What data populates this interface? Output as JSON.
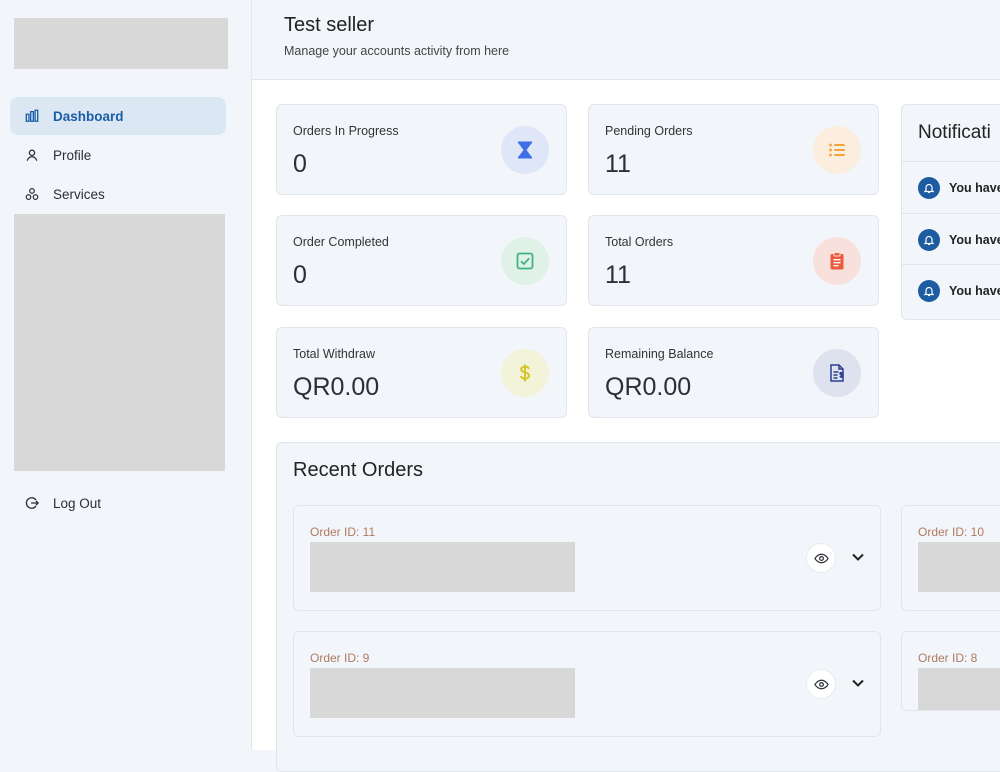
{
  "sidebar": {
    "items": [
      {
        "label": "Dashboard",
        "icon": "bar-chart-icon",
        "active": true
      },
      {
        "label": "Profile",
        "icon": "user-icon",
        "active": false
      },
      {
        "label": "Services",
        "icon": "services-icon",
        "active": false
      }
    ],
    "logout_label": "Log Out"
  },
  "header": {
    "title": "Test seller",
    "subtitle": "Manage your accounts activity from here"
  },
  "stats": [
    {
      "label": "Orders In Progress",
      "value": "0",
      "icon": "hourglass-icon",
      "color": "#3f6ee8"
    },
    {
      "label": "Pending Orders",
      "value": "11",
      "icon": "list-icon",
      "color": "#f4a23a"
    },
    {
      "label": "Order Completed",
      "value": "0",
      "icon": "check-square-icon",
      "color": "#3fb37f"
    },
    {
      "label": "Total Orders",
      "value": "11",
      "icon": "clipboard-icon",
      "color": "#ee5a3c"
    },
    {
      "label": "Total Withdraw",
      "value": "QR0.00",
      "icon": "dollar-icon",
      "color": "#d4c62a"
    },
    {
      "label": "Remaining Balance",
      "value": "QR0.00",
      "icon": "invoice-icon",
      "color": "#2a3f8f"
    }
  ],
  "notifications": {
    "title": "Notificati",
    "items": [
      "You have",
      "You have",
      "You have"
    ]
  },
  "recent_orders": {
    "title": "Recent Orders",
    "orders": [
      {
        "id_label": "Order ID: 11"
      },
      {
        "id_label": "Order ID: 10"
      },
      {
        "id_label": "Order ID: 9"
      },
      {
        "id_label": "Order ID: 8"
      }
    ]
  }
}
